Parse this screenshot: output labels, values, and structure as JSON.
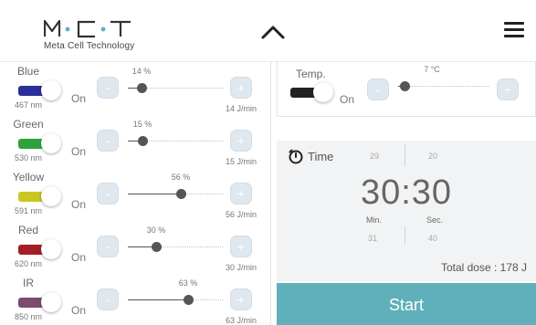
{
  "header": {
    "logo_sub": "Meta Cell Technology"
  },
  "lights": [
    {
      "name": "Blue",
      "on_label": "On",
      "wavelength": "467 nm",
      "percent_label": "14 %",
      "percent": 14,
      "dose": "14 J/min",
      "color": "#2b2f9a"
    },
    {
      "name": "Green",
      "on_label": "On",
      "wavelength": "530 nm",
      "percent_label": "15 %",
      "percent": 15,
      "dose": "15 J/min",
      "color": "#2ea33b"
    },
    {
      "name": "Yellow",
      "on_label": "On",
      "wavelength": "591 nm",
      "percent_label": "56 %",
      "percent": 56,
      "dose": "56 J/min",
      "color": "#c9c722"
    },
    {
      "name": "Red",
      "on_label": "On",
      "wavelength": "620 nm",
      "percent_label": "30 %",
      "percent": 30,
      "dose": "30 J/min",
      "color": "#a51e26"
    },
    {
      "name": "IR",
      "on_label": "On",
      "wavelength": "850 nm",
      "percent_label": "63 %",
      "percent": 63,
      "dose": "63 J/min",
      "color": "#7a4c6e"
    }
  ],
  "temp": {
    "name": "Temp.",
    "on_label": "On",
    "value_label": "7 °C",
    "level_percent": 7,
    "color": "#222222"
  },
  "timer": {
    "label": "Time",
    "prev_min": "29",
    "prev_sec": "20",
    "display": "30:30",
    "unit_min": "Min.",
    "unit_sec": "Sec.",
    "next_min": "31",
    "next_sec": "40",
    "total_dose": "Total dose : 178 J"
  },
  "buttons": {
    "minus": "-",
    "plus": "+",
    "start": "Start"
  },
  "colors": {
    "accent": "#5fb0ba",
    "button_bg": "#dfe7ef"
  },
  "icons": {
    "collapse": "chevron-up-icon",
    "menu": "hamburger-menu-icon",
    "timer": "stopwatch-icon"
  }
}
